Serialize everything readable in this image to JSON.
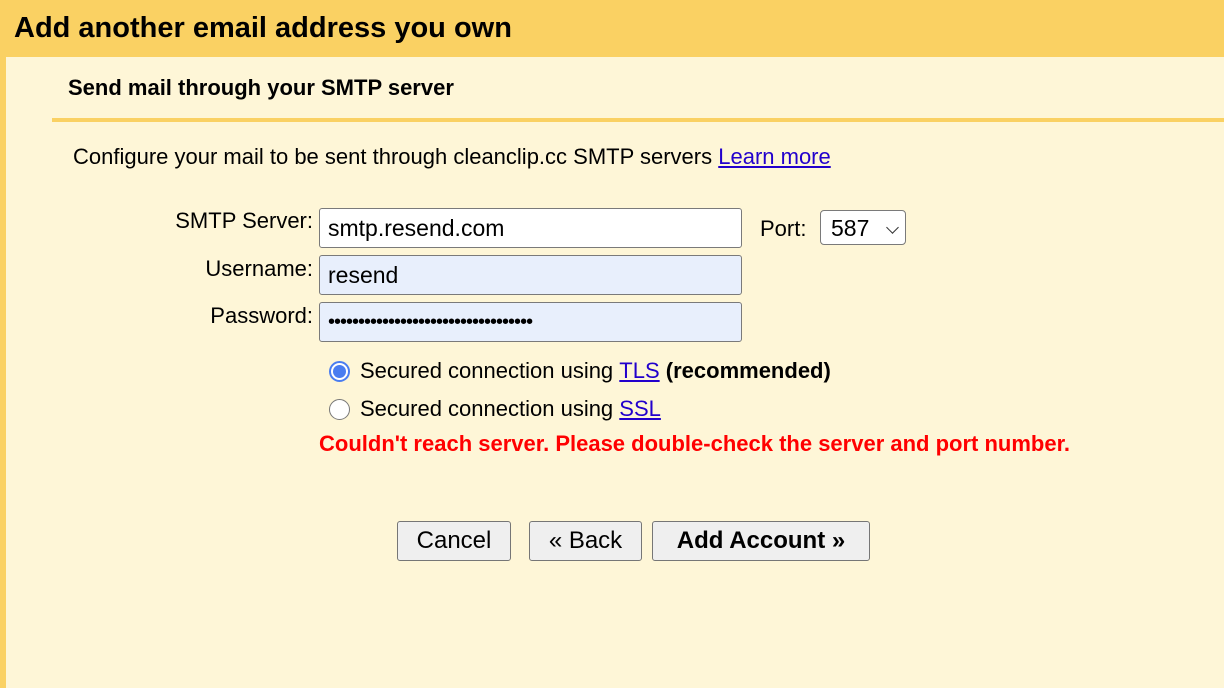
{
  "dialog": {
    "title": "Add another email address you own",
    "subtitle": "Send mail through your SMTP server",
    "description": "Configure your mail to be sent through cleanclip.cc SMTP servers",
    "learn_more": "Learn more"
  },
  "form": {
    "smtp_label": "SMTP Server:",
    "smtp_value": "smtp.resend.com",
    "username_label": "Username:",
    "username_value": "resend",
    "password_label": "Password:",
    "password_value": "••••••••••••••••••••••••••••••••••",
    "port_label": "Port:",
    "port_value": "587",
    "tls": {
      "prefix": "Secured connection using",
      "link": "TLS",
      "suffix": "(recommended)",
      "selected": true
    },
    "ssl": {
      "prefix": "Secured connection using",
      "link": "SSL",
      "selected": false
    },
    "error": "Couldn't reach server. Please double-check the server and port number."
  },
  "buttons": {
    "cancel": "Cancel",
    "back": "« Back",
    "add": "Add Account »"
  },
  "colors": {
    "header": "#fad163",
    "background": "#fef6d7",
    "error": "#ff0000",
    "link": "#2200cc",
    "radio": "#4a7df0"
  }
}
